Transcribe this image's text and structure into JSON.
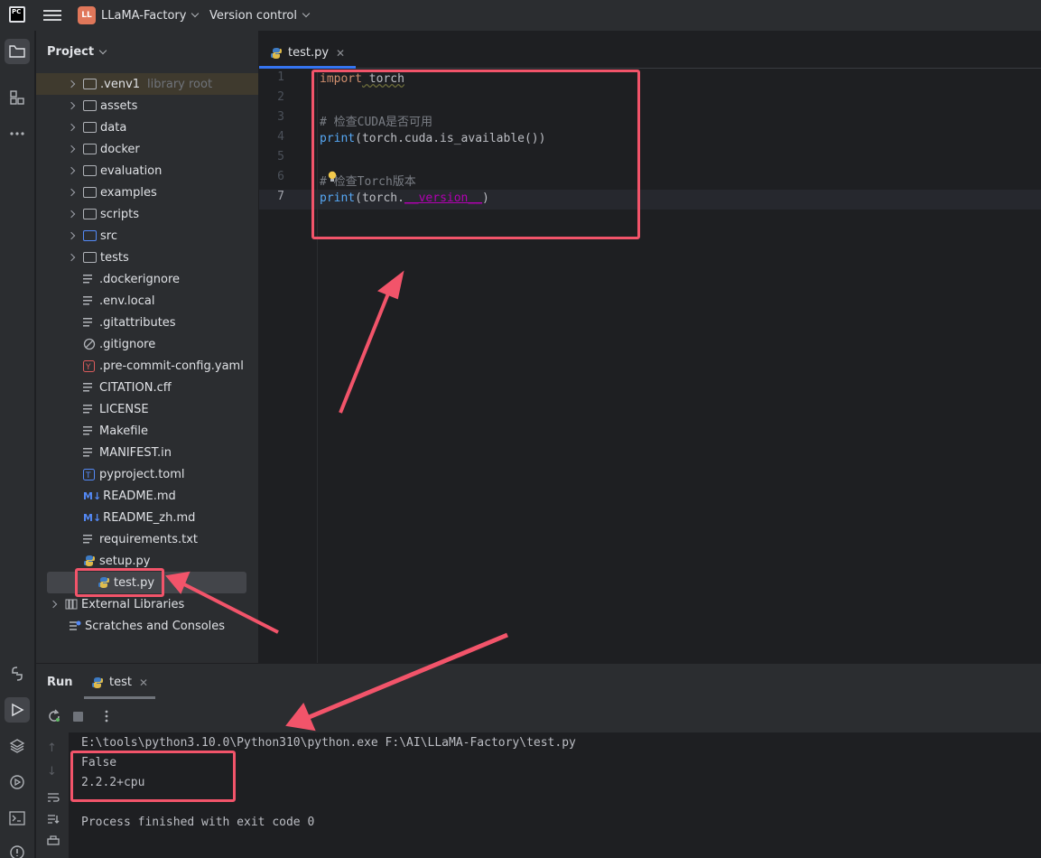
{
  "titlebar": {
    "app_logo": "PC",
    "project_badge": "LL",
    "project_name": "LLaMA-Factory",
    "vcs_label": "Version control"
  },
  "project_panel": {
    "title": "Project",
    "items": [
      {
        "label": ".venv1",
        "suffix": "library root",
        "kind": "folder-collapsed"
      },
      {
        "label": "assets",
        "kind": "folder-collapsed"
      },
      {
        "label": "data",
        "kind": "folder-collapsed"
      },
      {
        "label": "docker",
        "kind": "folder-collapsed"
      },
      {
        "label": "evaluation",
        "kind": "folder-collapsed"
      },
      {
        "label": "examples",
        "kind": "folder-collapsed"
      },
      {
        "label": "scripts",
        "kind": "folder-collapsed"
      },
      {
        "label": "src",
        "kind": "folder-collapsed-source"
      },
      {
        "label": "tests",
        "kind": "folder-collapsed"
      },
      {
        "label": ".dockerignore",
        "kind": "text-file"
      },
      {
        "label": ".env.local",
        "kind": "text-file"
      },
      {
        "label": ".gitattributes",
        "kind": "text-file"
      },
      {
        "label": ".gitignore",
        "kind": "ignore-file"
      },
      {
        "label": ".pre-commit-config.yaml",
        "kind": "yaml-file"
      },
      {
        "label": "CITATION.cff",
        "kind": "text-file"
      },
      {
        "label": "LICENSE",
        "kind": "text-file"
      },
      {
        "label": "Makefile",
        "kind": "text-file"
      },
      {
        "label": "MANIFEST.in",
        "kind": "text-file"
      },
      {
        "label": "pyproject.toml",
        "kind": "toml-file"
      },
      {
        "label": "README.md",
        "kind": "markdown-file"
      },
      {
        "label": "README_zh.md",
        "kind": "markdown-file"
      },
      {
        "label": "requirements.txt",
        "kind": "text-file"
      },
      {
        "label": "setup.py",
        "kind": "python-file"
      },
      {
        "label": "test.py",
        "kind": "python-file",
        "selected": true
      },
      {
        "label": "External Libraries",
        "kind": "libraries"
      },
      {
        "label": "Scratches and Consoles",
        "kind": "scratches"
      }
    ]
  },
  "editor": {
    "tab_label": "test.py",
    "line_numbers": [
      "1",
      "2",
      "3",
      "4",
      "5",
      "6",
      "7"
    ],
    "current_line": "7",
    "code": {
      "l1_kw": "import",
      "l1_mod": " torch",
      "l3": "# 检查CUDA是否可用",
      "l4_fn": "print",
      "l4_rest": "(torch.cuda.is_available())",
      "l6": "# 检查Torch版本",
      "l7_fn": "print",
      "l7_a": "(torch.",
      "l7_dunder": "__version__",
      "l7_b": ")"
    }
  },
  "run_panel": {
    "title": "Run",
    "tab_label": "test",
    "console": [
      "E:\\tools\\python3.10.0\\Python310\\python.exe F:\\AI\\LLaMA-Factory\\test.py",
      "False",
      "2.2.2+cpu",
      "",
      "Process finished with exit code 0"
    ]
  },
  "colors": {
    "annotation": "#f2546a",
    "accent": "#3574f0",
    "keyword": "#cf8e6d",
    "function": "#56a8f5",
    "comment": "#7a7e85",
    "dunder": "#b200b2"
  }
}
